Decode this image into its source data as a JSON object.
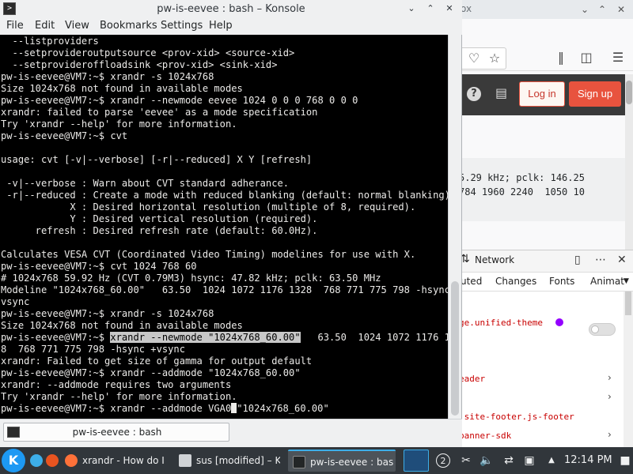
{
  "konsole": {
    "title": "pw-is-eevee : bash – Konsole",
    "menu": [
      "File",
      "Edit",
      "View",
      "Bookmarks",
      "Settings",
      "Help"
    ],
    "lines": [
      "  --listproviders",
      "  --setprovideroutputsource <prov-xid> <source-xid>",
      "  --setprovideroffloadsink <prov-xid> <sink-xid>",
      "pw-is-eevee@VM7:~$ xrandr -s 1024x768",
      "Size 1024x768 not found in available modes",
      "pw-is-eevee@VM7:~$ xrandr --newmode eevee 1024 0 0 0 768 0 0 0",
      "xrandr: failed to parse 'eevee' as a mode specification",
      "Try 'xrandr --help' for more information.",
      "pw-is-eevee@VM7:~$ cvt",
      "",
      "usage: cvt [-v|--verbose] [-r|--reduced] X Y [refresh]",
      "",
      " -v|--verbose : Warn about CVT standard adherance.",
      " -r|--reduced : Create a mode with reduced blanking (default: normal blanking).",
      "            X : Desired horizontal resolution (multiple of 8, required).",
      "            Y : Desired vertical resolution (required).",
      "      refresh : Desired refresh rate (default: 60.0Hz).",
      "",
      "Calculates VESA CVT (Coordinated Video Timing) modelines for use with X.",
      "pw-is-eevee@VM7:~$ cvt 1024 768 60",
      "# 1024x768 59.92 Hz (CVT 0.79M3) hsync: 47.82 kHz; pclk: 63.50 MHz",
      "Modeline \"1024x768_60.00\"   63.50  1024 1072 1176 1328  768 771 775 798 -hsync +",
      "vsync",
      "pw-is-eevee@VM7:~$ xrandr -s 1024x768",
      "Size 1024x768 not found in available modes"
    ],
    "sel_prompt": "pw-is-eevee@VM7:~$ ",
    "sel_text": "xrandr --newmode \"1024x768_60.00\"",
    "sel_rest": "   63.50  1024 1072 1176 132",
    "lines2": [
      "8  768 771 775 798 -hsync +vsync",
      "xrandr: Failed to get size of gamma for output default",
      "pw-is-eevee@VM7:~$ xrandr --addmode \"1024x768_60.00\"",
      "xrandr: --addmode requires two arguments",
      "Try 'xrandr --help' for more information."
    ],
    "last_before_cursor": "pw-is-eevee@VM7:~$ xrandr --addmode VGA0",
    "last_after_cursor": "\"1024x768_60.00\"",
    "tab_label": "pw-is-eevee : bash"
  },
  "firefox": {
    "title_fragment": "ox",
    "login_label": "Log in",
    "signup_label": "Sign up",
    "code_lines": [
      "5.29 kHz; pclk: 146.25",
      "784 1960 2240  1050 10"
    ],
    "devtools": {
      "network_label": "Network",
      "subtabs": [
        "uted",
        "Changes",
        "Fonts",
        "Animat"
      ],
      "rows": [
        "ge.unified-theme",
        "eader",
        ".site-footer.js-footer",
        "banner-sdk"
      ]
    }
  },
  "taskbar": {
    "tasks": [
      {
        "label": "xrandr - How do I se"
      },
      {
        "label": "sus [modified] – Kat"
      },
      {
        "label": "pw-is-eevee : bash –"
      }
    ],
    "pager_number": "2",
    "clock": "12:14 PM"
  },
  "colors": {
    "terminal_bg": "#000000",
    "terminal_fg": "#ecebe9",
    "signup_bg": "#e8533e",
    "taskbar_bg": "#31363b",
    "devtools_purple": "#9400ff"
  }
}
